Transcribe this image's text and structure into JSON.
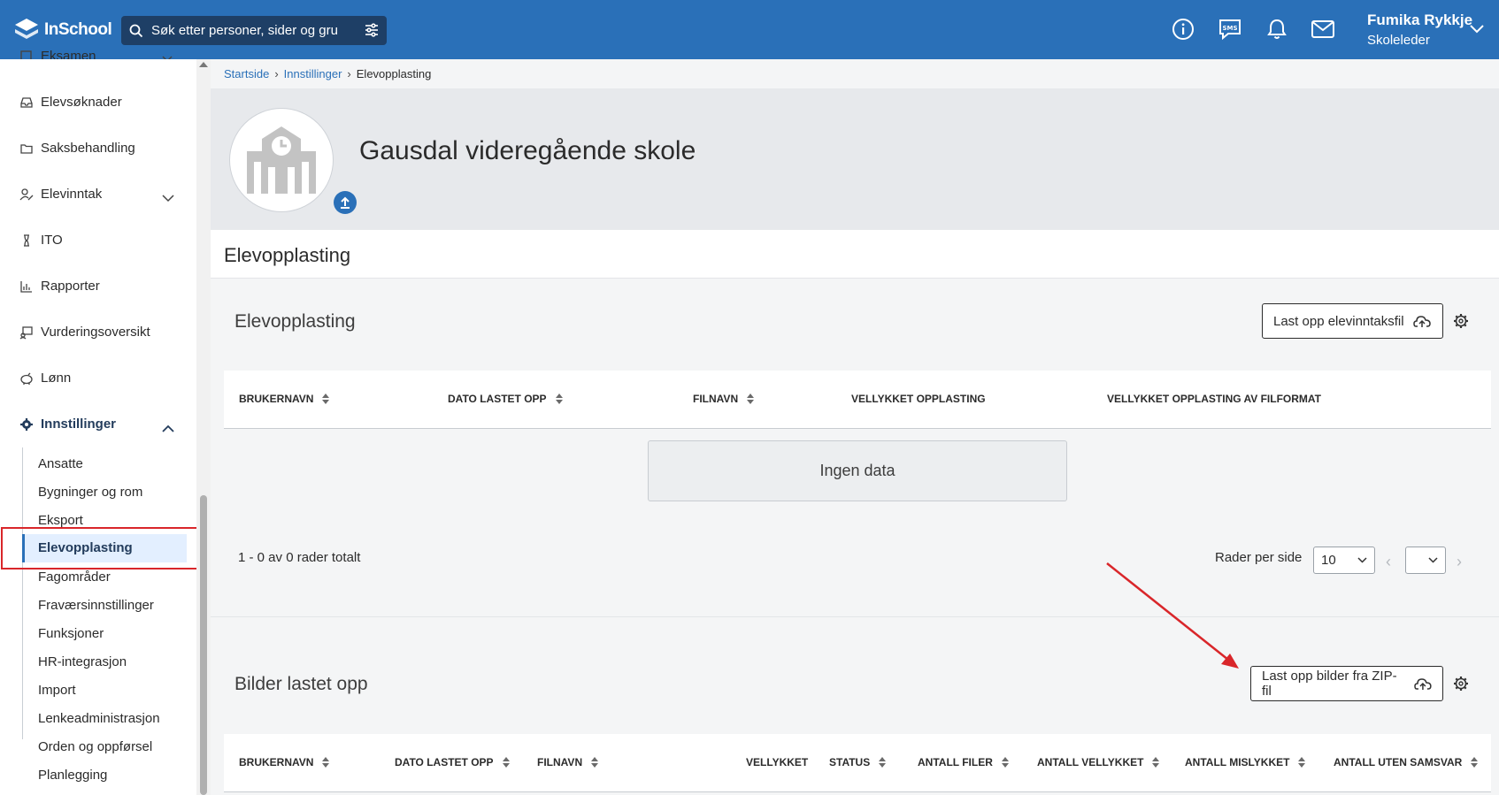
{
  "topbar": {
    "logo_text": "InSchool",
    "search_placeholder": "Søk etter personer, sider og gru",
    "user_name": "Fumika Rykkje",
    "user_role": "Skoleleder",
    "icons": [
      "info-icon",
      "sms-icon",
      "bell-icon",
      "mail-icon"
    ]
  },
  "sidebar": {
    "items": [
      {
        "label": "Eksamen",
        "icon": "exam-icon"
      },
      {
        "label": "Elevsøknader",
        "icon": "inbox-icon"
      },
      {
        "label": "Saksbehandling",
        "icon": "folder-icon"
      },
      {
        "label": "Elevinntak",
        "icon": "user-edit-icon"
      },
      {
        "label": "ITO",
        "icon": "hourglass-icon"
      },
      {
        "label": "Rapporter",
        "icon": "chart-icon"
      },
      {
        "label": "Vurderingsoversikt",
        "icon": "assessment-icon"
      },
      {
        "label": "Lønn",
        "icon": "piggy-bank-icon"
      },
      {
        "label": "Innstillinger",
        "icon": "gear-icon"
      }
    ],
    "subitems": [
      "Ansatte",
      "Bygninger og rom",
      "Eksport",
      "Elevopplasting",
      "Fagområder",
      "Fraværsinnstillinger",
      "Funksjoner",
      "HR-integrasjon",
      "Import",
      "Lenkeadministrasjon",
      "Orden og oppførsel",
      "Planlegging"
    ],
    "active_subitem": "Elevopplasting"
  },
  "breadcrumb": {
    "items": [
      "Startside",
      "Innstillinger",
      "Elevopplasting"
    ]
  },
  "header": {
    "school_name": "Gausdal videregående skole"
  },
  "page_title": "Elevopplasting",
  "upload_section": {
    "title": "Elevopplasting",
    "button_label": "Last opp elevinntaksfil",
    "columns": [
      "BRUKERNAVN",
      "DATO LASTET OPP",
      "FILNAVN",
      "VELLYKKET OPPLASTING",
      "VELLYKKET OPPLASTING AV FILFORMAT"
    ],
    "empty_text": "Ingen data",
    "rows_total": "1 - 0 av 0 rader totalt",
    "rows_per_page_label": "Rader per side",
    "rows_per_page_value": "10"
  },
  "images_section": {
    "title": "Bilder lastet opp",
    "button_label": "Last opp bilder fra ZIP-fil",
    "columns": [
      "BRUKERNAVN",
      "DATO LASTET OPP",
      "FILNAVN",
      "VELLYKKET",
      "STATUS",
      "ANTALL FILER",
      "ANTALL VELLYKKET",
      "ANTALL MISLYKKET",
      "ANTALL UTEN SAMSVAR"
    ]
  },
  "colors": {
    "topbar": "#2a70b8",
    "search": "#1e3f66",
    "annotation": "#d9262a",
    "active_bg": "#e3efff"
  }
}
